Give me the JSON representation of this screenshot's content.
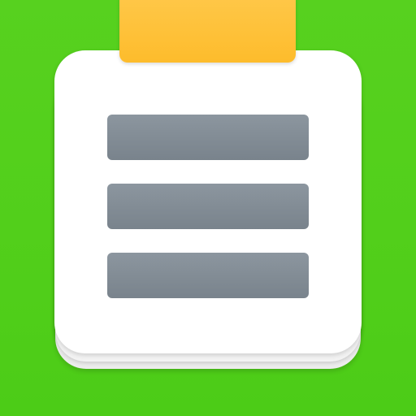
{
  "icon": {
    "name": "notepad-app-icon",
    "colors": {
      "background": "#52cf1b",
      "page": "#ffffff",
      "clip": "#fdbc2c",
      "lines": "#7f8992"
    },
    "line_count": 3
  }
}
